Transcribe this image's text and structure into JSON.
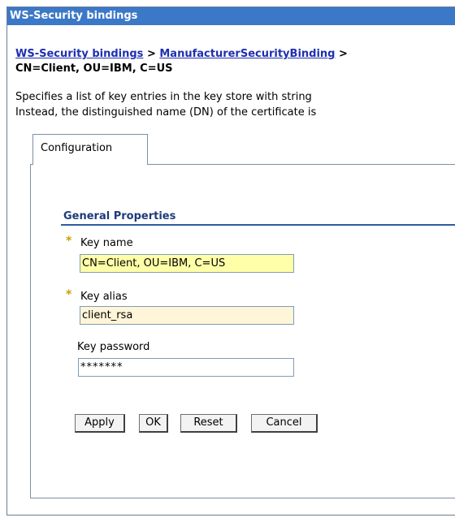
{
  "window": {
    "title": "WS-Security bindings"
  },
  "breadcrumb": {
    "link1": "WS-Security bindings",
    "separator": ">",
    "link2": "ManufacturerSecurityBinding",
    "separator2": ">",
    "current": "CN=Client, OU=IBM, C=US"
  },
  "description": {
    "line1": "Specifies a list of key entries in the key store with string",
    "line2": "Instead, the distinguished name (DN) of the certificate is"
  },
  "tabs": [
    {
      "label": "Configuration"
    }
  ],
  "section": {
    "title": "General Properties"
  },
  "form": {
    "required_marker": "*",
    "key_name_label": "Key name",
    "key_name_value": "CN=Client, OU=IBM, C=US",
    "key_alias_label": "Key alias",
    "key_alias_value": "client_rsa",
    "key_password_label": "Key password",
    "key_password_value": "*******"
  },
  "buttons": {
    "apply": "Apply",
    "ok": "OK",
    "reset": "Reset",
    "cancel": "Cancel"
  },
  "colors": {
    "titlebar": "#3c78c8",
    "link": "#1f2fb0",
    "required_field": "#ffffa8",
    "alias_field": "#fff5d8",
    "section_title": "#1f3a7a",
    "required_marker": "#c8a000"
  }
}
